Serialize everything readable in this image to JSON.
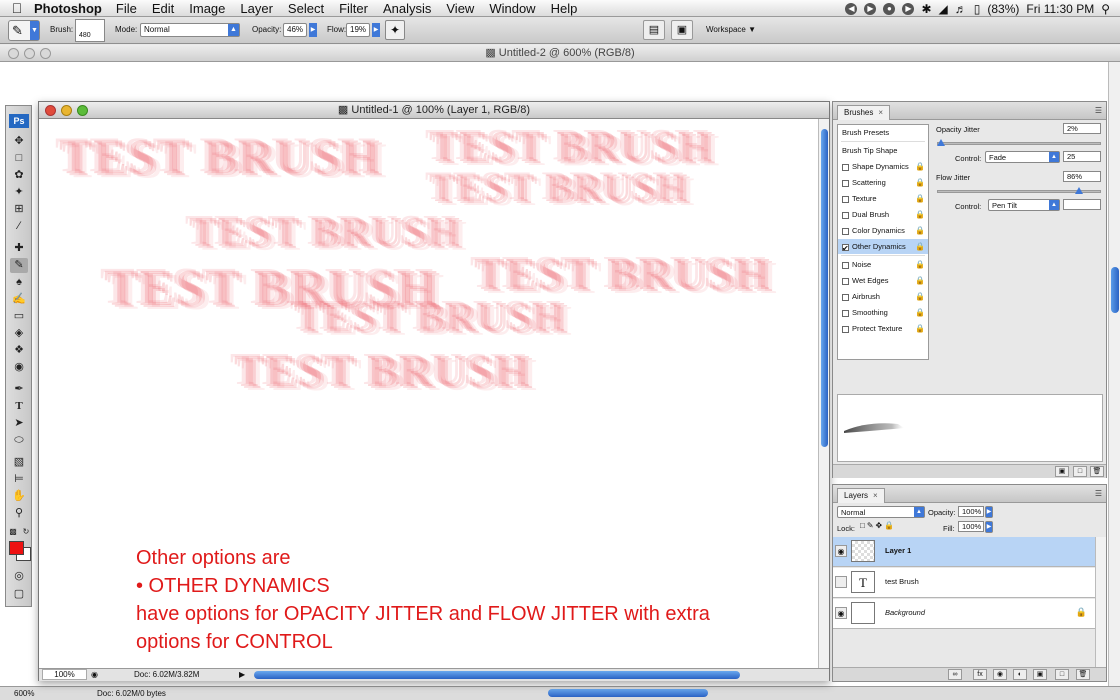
{
  "menubar": {
    "app_name": "Photoshop",
    "items": [
      "File",
      "Edit",
      "Image",
      "Layer",
      "Select",
      "Filter",
      "Analysis",
      "View",
      "Window",
      "Help"
    ],
    "battery": "(83%)",
    "clock": "Fri 11:30 PM"
  },
  "options_bar": {
    "brush_label": "Brush:",
    "brush_size": "480",
    "mode_label": "Mode:",
    "mode_value": "Normal",
    "opacity_label": "Opacity:",
    "opacity_value": "46%",
    "flow_label": "Flow:",
    "flow_value": "19%",
    "workspace_label": "Workspace"
  },
  "background_doc": {
    "title": "Untitled-2 @ 600% (RGB/8)",
    "zoom": "600%",
    "doc_info": "Doc: 6.02M/0 bytes"
  },
  "document": {
    "title": "Untitled-1 @ 100% (Layer 1, RGB/8)",
    "zoom": "100%",
    "doc_info": "Doc: 6.02M/3.82M",
    "canvas_text": "TEST BRUSH",
    "annotation_lines": [
      "Other options are",
      "• OTHER DYNAMICS",
      "have options for OPACITY JITTER and FLOW JITTER with extra",
      "options for CONTROL"
    ]
  },
  "brushes_panel": {
    "tab": "Brushes",
    "list": [
      {
        "label": "Brush Presets",
        "header": true
      },
      {
        "label": "Brush Tip Shape",
        "header": true
      },
      {
        "label": "Shape Dynamics",
        "checked": false
      },
      {
        "label": "Scattering",
        "checked": false
      },
      {
        "label": "Texture",
        "checked": false
      },
      {
        "label": "Dual Brush",
        "checked": false
      },
      {
        "label": "Color Dynamics",
        "checked": false
      },
      {
        "label": "Other Dynamics",
        "checked": true,
        "selected": true
      },
      {
        "label": "Noise",
        "checked": false
      },
      {
        "label": "Wet Edges",
        "checked": false
      },
      {
        "label": "Airbrush",
        "checked": false
      },
      {
        "label": "Smoothing",
        "checked": false
      },
      {
        "label": "Protect Texture",
        "checked": false
      }
    ],
    "opacity_jitter_label": "Opacity Jitter",
    "opacity_jitter_value": "2%",
    "opacity_jitter_level": 0.02,
    "opacity_control_label": "Control:",
    "opacity_control_value": "Fade",
    "opacity_fade_steps": "25",
    "flow_jitter_label": "Flow Jitter",
    "flow_jitter_value": "86%",
    "flow_jitter_level": 0.86,
    "flow_control_label": "Control:",
    "flow_control_value": "Pen Tilt",
    "flow_control_extra": ""
  },
  "layers_panel": {
    "tab": "Layers",
    "blend_mode": "Normal",
    "opacity_label": "Opacity:",
    "opacity_value": "100%",
    "lock_label": "Lock:",
    "fill_label": "Fill:",
    "fill_value": "100%",
    "layers": [
      {
        "name": "Layer 1",
        "visible": true,
        "selected": true,
        "type": "pixel"
      },
      {
        "name": "test Brush",
        "visible": false,
        "selected": false,
        "type": "text",
        "thumb_glyph": "T"
      },
      {
        "name": "Background",
        "visible": true,
        "selected": false,
        "type": "background",
        "locked": true
      }
    ]
  }
}
